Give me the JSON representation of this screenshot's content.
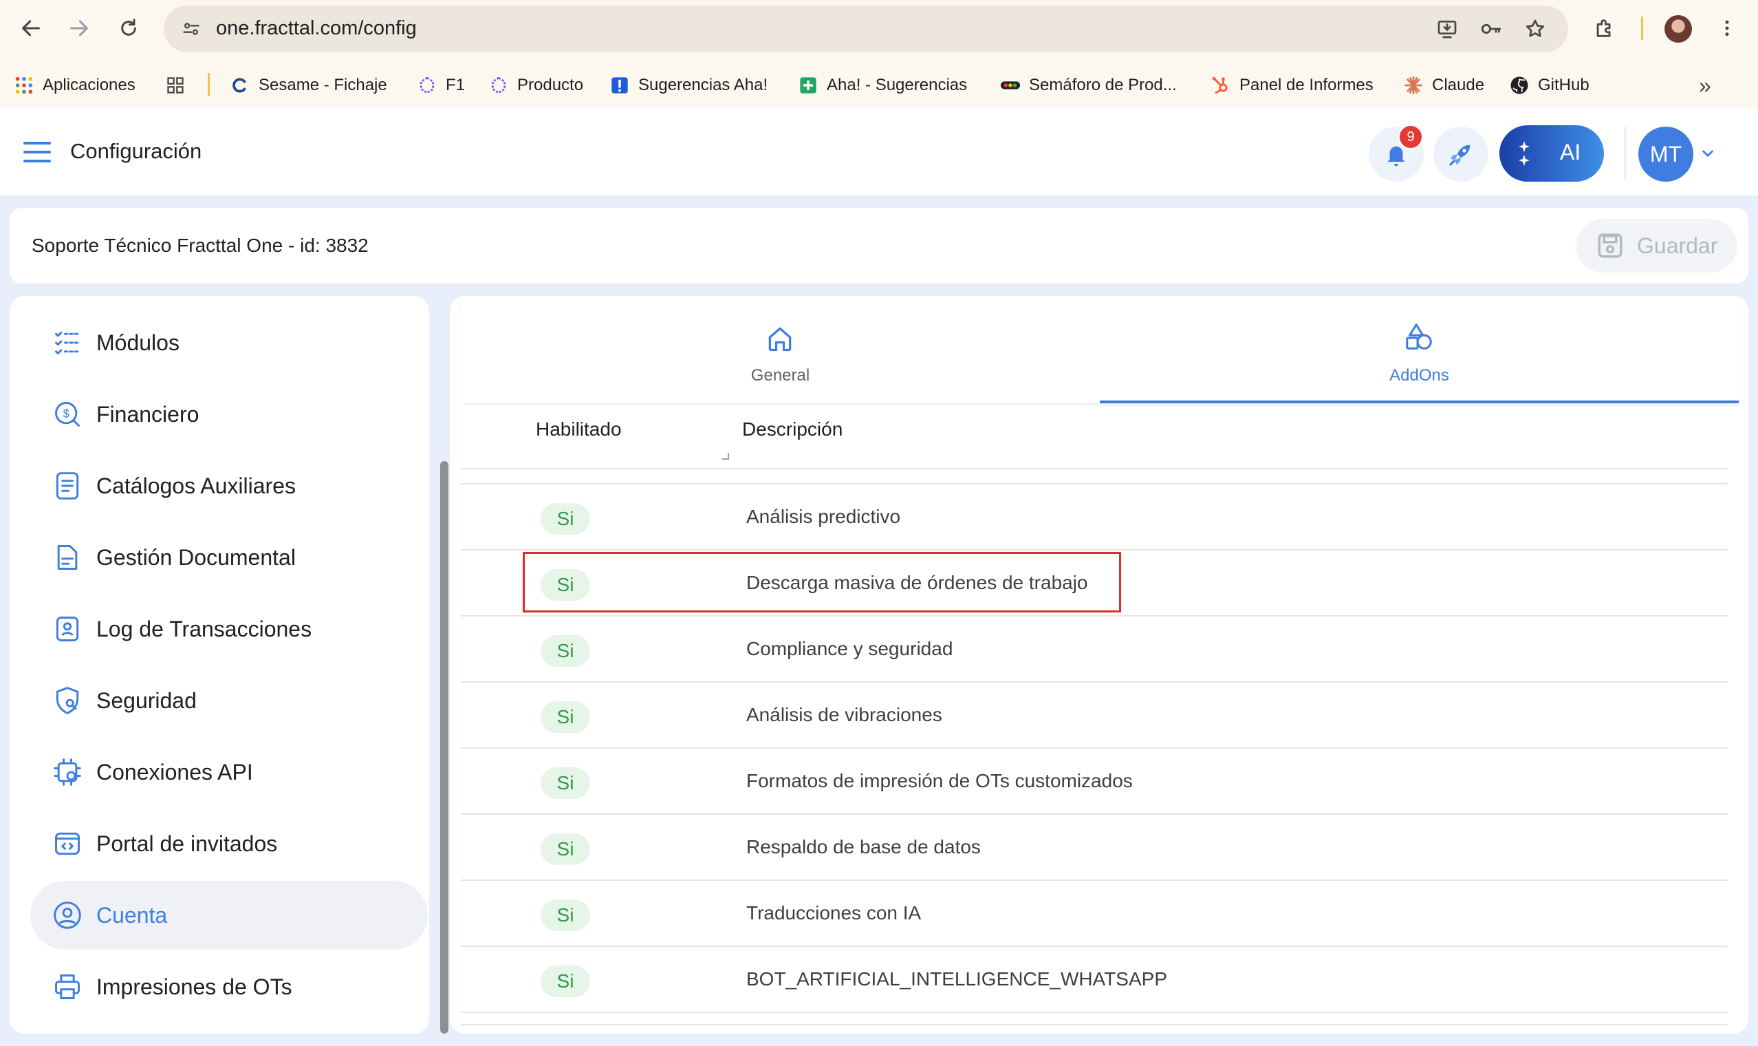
{
  "browser": {
    "url": "one.fracttal.com/config",
    "bookmarks": [
      {
        "label": "Aplicaciones",
        "icon": "apps-grid-icon"
      },
      {
        "label": "",
        "icon": "tab-groups-icon"
      },
      {
        "label": "Sesame - Fichaje",
        "icon": "sesame-icon"
      },
      {
        "label": "F1",
        "icon": "f1-icon"
      },
      {
        "label": "Producto",
        "icon": "producto-icon"
      },
      {
        "label": "Sugerencias Aha!",
        "icon": "aha-icon"
      },
      {
        "label": "Aha! - Sugerencias",
        "icon": "sheets-icon"
      },
      {
        "label": "Semáforo de Prod...",
        "icon": "traffic-light-icon"
      },
      {
        "label": "Panel de Informes",
        "icon": "hubspot-icon"
      },
      {
        "label": "Claude",
        "icon": "claude-icon"
      },
      {
        "label": "GitHub",
        "icon": "github-icon"
      }
    ],
    "overflow": "»"
  },
  "appbar": {
    "title": "Configuración",
    "notification_count": "9",
    "ai_label": "AI",
    "avatar_initials": "MT"
  },
  "subheader": {
    "company": "Soporte Técnico Fracttal One - id: 3832",
    "save_label": "Guardar"
  },
  "sidebar": {
    "items": [
      {
        "label": "Módulos",
        "icon": "checklist-icon",
        "active": false
      },
      {
        "label": "Financiero",
        "icon": "money-search-icon",
        "active": false
      },
      {
        "label": "Catálogos Auxiliares",
        "icon": "catalog-icon",
        "active": false
      },
      {
        "label": "Gestión Documental",
        "icon": "document-icon",
        "active": false
      },
      {
        "label": "Log de Transacciones",
        "icon": "log-icon",
        "active": false
      },
      {
        "label": "Seguridad",
        "icon": "shield-search-icon",
        "active": false
      },
      {
        "label": "Conexiones API",
        "icon": "api-chip-icon",
        "active": false
      },
      {
        "label": "Portal de invitados",
        "icon": "portal-icon",
        "active": false
      },
      {
        "label": "Cuenta",
        "icon": "account-circle-icon",
        "active": true
      },
      {
        "label": "Impresiones de OTs",
        "icon": "printer-icon",
        "active": false
      }
    ]
  },
  "tabs": [
    {
      "label": "General",
      "icon": "home-icon",
      "active": false
    },
    {
      "label": "AddOns",
      "icon": "shapes-icon",
      "active": true
    }
  ],
  "table": {
    "columns": [
      "Habilitado",
      "Descripción"
    ],
    "rows": [
      {
        "enabled": "Si",
        "description": "Análisis predictivo"
      },
      {
        "enabled": "Si",
        "description": "Descarga masiva de órdenes de trabajo",
        "highlighted": true
      },
      {
        "enabled": "Si",
        "description": "Compliance y seguridad"
      },
      {
        "enabled": "Si",
        "description": "Análisis de vibraciones"
      },
      {
        "enabled": "Si",
        "description": "Formatos de impresión de OTs customizados"
      },
      {
        "enabled": "Si",
        "description": "Respaldo de base de datos"
      },
      {
        "enabled": "Si",
        "description": "Traducciones con IA"
      },
      {
        "enabled": "Si",
        "description": "BOT_ARTIFICIAL_INTELLIGENCE_WHATSAPP"
      }
    ]
  },
  "colors": {
    "accent": "#3f7ee0",
    "chip_bg": "#e6f5e8",
    "chip_text": "#2e9a49",
    "highlight_border": "#d93025",
    "badge": "#e53935"
  }
}
